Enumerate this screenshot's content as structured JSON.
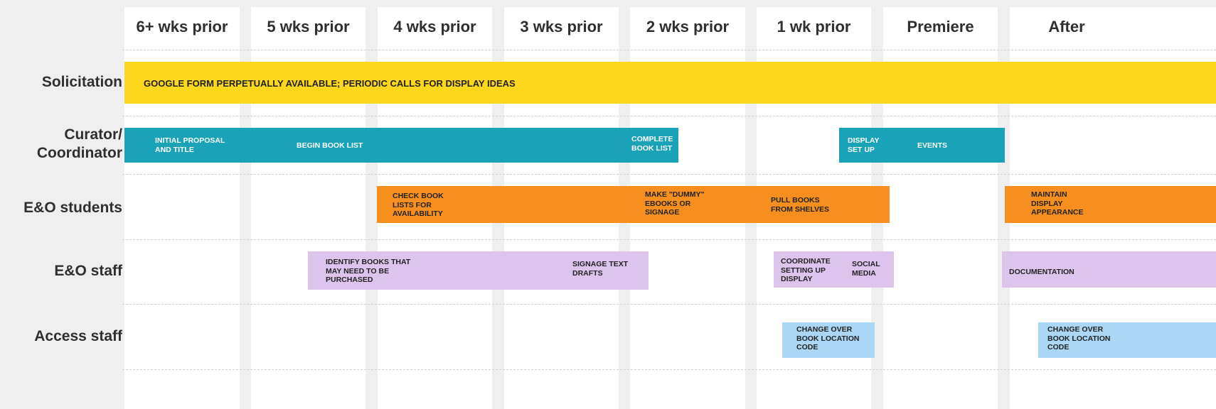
{
  "columns": [
    "6+ wks prior",
    "5 wks prior",
    "4 wks prior",
    "3 wks prior",
    "2 wks prior",
    "1 wk prior",
    "Premiere",
    "After"
  ],
  "rows": {
    "solicitation": "Solicitation",
    "curator_line1": "Curator/",
    "curator_line2": "Coordinator",
    "eo_students": "E&O students",
    "eo_staff": "E&O staff",
    "access_staff": "Access staff"
  },
  "tasks": {
    "solicitation": "GOOGLE FORM PERPETUALLY AVAILABLE;  PERIODIC CALLS FOR DISPLAY IDEAS",
    "curator": {
      "initial_proposal": "INITIAL PROPOSAL AND TITLE",
      "begin_book_list": "BEGIN BOOK LIST",
      "complete_book_list": "COMPLETE BOOK LIST",
      "display_set_up": "DISPLAY SET UP",
      "events": "EVENTS"
    },
    "students": {
      "check_book_lists": "CHECK BOOK LISTS FOR AVAILABILITY",
      "make_dummy": "MAKE \"DUMMY\" EBOOKS OR SIGNAGE",
      "pull_books": "PULL BOOKS FROM SHELVES",
      "maintain_display": "MAINTAIN DISPLAY APPEARANCE"
    },
    "staff": {
      "identify_books": "IDENTIFY BOOKS THAT MAY NEED TO BE PURCHASED",
      "signage_drafts": "SIGNAGE TEXT DRAFTS",
      "coordinate_setting": "COORDINATE SETTING UP DISPLAY",
      "social_media": "SOCIAL MEDIA",
      "documentation": "DOCUMENTATION"
    },
    "access": {
      "change_over_1": "CHANGE OVER BOOK LOCATION CODE",
      "change_over_2": "CHANGE OVER BOOK LOCATION CODE"
    }
  },
  "colors": {
    "background": "#efefef",
    "column": "#ffffff",
    "solicitation": "#fdd71c",
    "curator": "#1aa3b8",
    "students": "#f78f1e",
    "staff": "#dcc4ec",
    "access": "#aad7f5"
  }
}
